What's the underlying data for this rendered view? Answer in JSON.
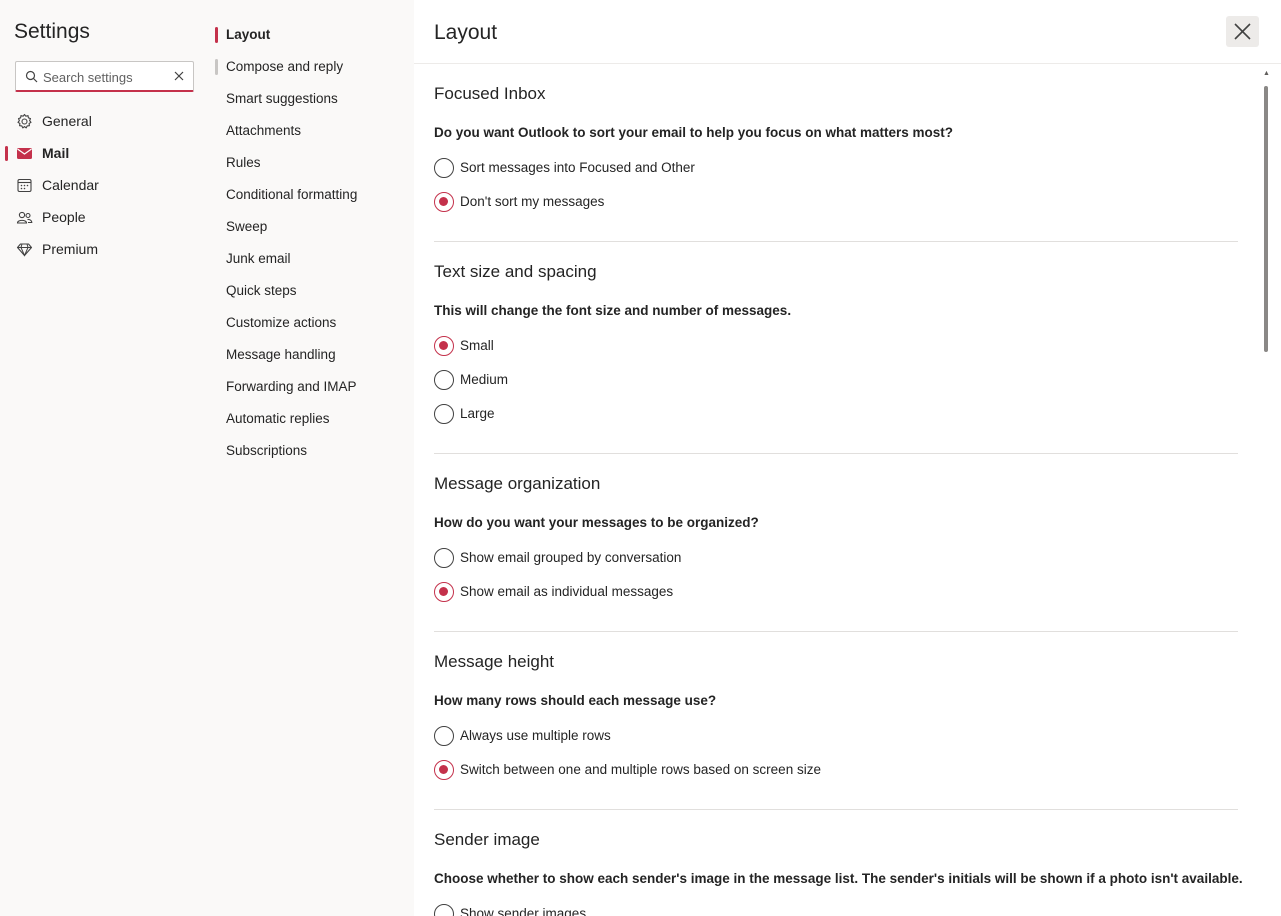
{
  "settings_title": "Settings",
  "search": {
    "placeholder": "Search settings"
  },
  "categories": [
    {
      "label": "General",
      "icon": "gear-icon"
    },
    {
      "label": "Mail",
      "icon": "mail-icon",
      "selected": true
    },
    {
      "label": "Calendar",
      "icon": "calendar-icon"
    },
    {
      "label": "People",
      "icon": "people-icon"
    },
    {
      "label": "Premium",
      "icon": "diamond-icon"
    }
  ],
  "subcategories": [
    {
      "label": "Layout",
      "selected": true
    },
    {
      "label": "Compose and reply"
    },
    {
      "label": "Smart suggestions"
    },
    {
      "label": "Attachments"
    },
    {
      "label": "Rules"
    },
    {
      "label": "Conditional formatting"
    },
    {
      "label": "Sweep"
    },
    {
      "label": "Junk email"
    },
    {
      "label": "Quick steps"
    },
    {
      "label": "Customize actions"
    },
    {
      "label": "Message handling"
    },
    {
      "label": "Forwarding and IMAP"
    },
    {
      "label": "Automatic replies"
    },
    {
      "label": "Subscriptions"
    }
  ],
  "page_title": "Layout",
  "sections": {
    "focused": {
      "title": "Focused Inbox",
      "question": "Do you want Outlook to sort your email to help you focus on what matters most?",
      "options": [
        "Sort messages into Focused and Other",
        "Don't sort my messages"
      ],
      "selected": 1
    },
    "textsize": {
      "title": "Text size and spacing",
      "question": "This will change the font size and number of messages.",
      "options": [
        "Small",
        "Medium",
        "Large"
      ],
      "selected": 0
    },
    "organization": {
      "title": "Message organization",
      "question": "How do you want your messages to be organized?",
      "options": [
        "Show email grouped by conversation",
        "Show email as individual messages"
      ],
      "selected": 1
    },
    "height": {
      "title": "Message height",
      "question": "How many rows should each message use?",
      "options": [
        "Always use multiple rows",
        "Switch between one and multiple rows based on screen size"
      ],
      "selected": 1
    },
    "sender": {
      "title": "Sender image",
      "question": "Choose whether to show each sender's image in the message list. The sender's initials will be shown if a photo isn't available.",
      "options": [
        "Show sender images"
      ]
    }
  },
  "colors": {
    "accent": "#c4314b",
    "nav_bg": "#faf9f8",
    "main_bg": "#ffffff"
  }
}
